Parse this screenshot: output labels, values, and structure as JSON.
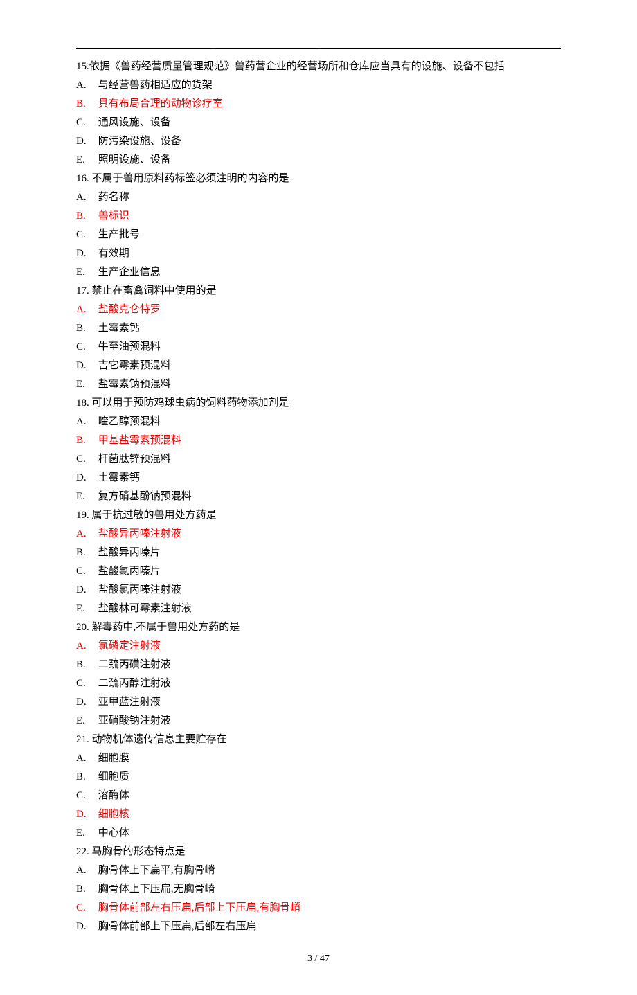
{
  "header": {
    "dot_left": ".",
    "dot_right": "."
  },
  "questions": [
    {
      "number": "15.",
      "text": "依据《兽药经营质量管理规范》兽药营企业的经营场所和仓库应当具有的设施、设备不包括",
      "options": [
        {
          "label": "A.",
          "text": "与经营兽药相适应的货架",
          "answer": false
        },
        {
          "label": "B.",
          "text": "具有布局合理的动物诊疗室",
          "answer": true
        },
        {
          "label": "C.",
          "text": "通风设施、设备",
          "answer": false
        },
        {
          "label": "D.",
          "text": "防污染设施、设备",
          "answer": false
        },
        {
          "label": "E.",
          "text": "照明设施、设备",
          "answer": false
        }
      ]
    },
    {
      "number": "16.",
      "text": " 不属于兽用原料药标签必须注明的内容的是",
      "options": [
        {
          "label": "A.",
          "text": "药名称",
          "answer": false
        },
        {
          "label": "B.",
          "text": "兽标识",
          "answer": true
        },
        {
          "label": "C.",
          "text": "生产批号",
          "answer": false
        },
        {
          "label": "D.",
          "text": "有效期",
          "answer": false
        },
        {
          "label": "E.",
          "text": "生产企业信息",
          "answer": false
        }
      ]
    },
    {
      "number": "17.",
      "text": " 禁止在畜禽饲料中使用的是",
      "options": [
        {
          "label": "A.",
          "text": "盐酸克仑特罗",
          "answer": true
        },
        {
          "label": "B.",
          "text": "土霉素钙",
          "answer": false
        },
        {
          "label": "C.",
          "text": "牛至油预混料",
          "answer": false
        },
        {
          "label": "D.",
          "text": "吉它霉素预混料",
          "answer": false
        },
        {
          "label": "E.",
          "text": "盐霉素钠预混料",
          "answer": false
        }
      ]
    },
    {
      "number": "18.",
      "text": " 可以用于预防鸡球虫病的饲料药物添加剂是",
      "options": [
        {
          "label": "A.",
          "text": "喹乙醇预混料",
          "answer": false
        },
        {
          "label": "B.",
          "text": "甲基盐霉素预混料",
          "answer": true
        },
        {
          "label": "C.",
          "text": "杆菌肽锌预混料",
          "answer": false
        },
        {
          "label": "D.",
          "text": "土霉素钙",
          "answer": false
        },
        {
          "label": "E.",
          "text": "复方硝基酚钠预混料",
          "answer": false
        }
      ]
    },
    {
      "number": "19.",
      "text": " 属于抗过敏的兽用处方药是",
      "options": [
        {
          "label": "A.",
          "text": "盐酸异丙嗪注射液",
          "answer": true
        },
        {
          "label": "B.",
          "text": "盐酸异丙嗪片",
          "answer": false
        },
        {
          "label": "C.",
          "text": "盐酸氯丙嗪片",
          "answer": false
        },
        {
          "label": "D.",
          "text": "盐酸氯丙嗪注射液",
          "answer": false
        },
        {
          "label": "E.",
          "text": "盐酸林可霉素注射液",
          "answer": false
        }
      ]
    },
    {
      "number": "20.",
      "text": " 解毒药中,不属于兽用处方药的是",
      "options": [
        {
          "label": "A.",
          "text": "氯磷定注射液",
          "answer": true
        },
        {
          "label": "B.",
          "text": "二巯丙磺注射液",
          "answer": false
        },
        {
          "label": "C.",
          "text": "二巯丙醇注射液",
          "answer": false
        },
        {
          "label": "D.",
          "text": "亚甲蓝注射液",
          "answer": false
        },
        {
          "label": "E.",
          "text": "亚硝酸钠注射液",
          "answer": false
        }
      ]
    },
    {
      "number": "21.",
      "text": " 动物机体遗传信息主要贮存在",
      "options": [
        {
          "label": "A.",
          "text": "细胞膜",
          "answer": false
        },
        {
          "label": "B.",
          "text": "细胞质",
          "answer": false
        },
        {
          "label": "C.",
          "text": "溶酶体",
          "answer": false
        },
        {
          "label": "D.",
          "text": "细胞核",
          "answer": true
        },
        {
          "label": "E.",
          "text": "中心体",
          "answer": false
        }
      ]
    },
    {
      "number": "22.",
      "text": " 马胸骨的形态特点是",
      "options": [
        {
          "label": "A.",
          "text": "胸骨体上下扁平,有胸骨嵴",
          "answer": false
        },
        {
          "label": "B.",
          "text": "胸骨体上下压扁,无胸骨嵴",
          "answer": false
        },
        {
          "label": "C.",
          "text": "胸骨体前部左右压扁,后部上下压扁,有胸骨嵴",
          "answer": true
        },
        {
          "label": "D.",
          "text": "胸骨体前部上下压扁,后部左右压扁",
          "answer": false
        }
      ]
    }
  ],
  "footer": {
    "page": "3 / 47"
  }
}
